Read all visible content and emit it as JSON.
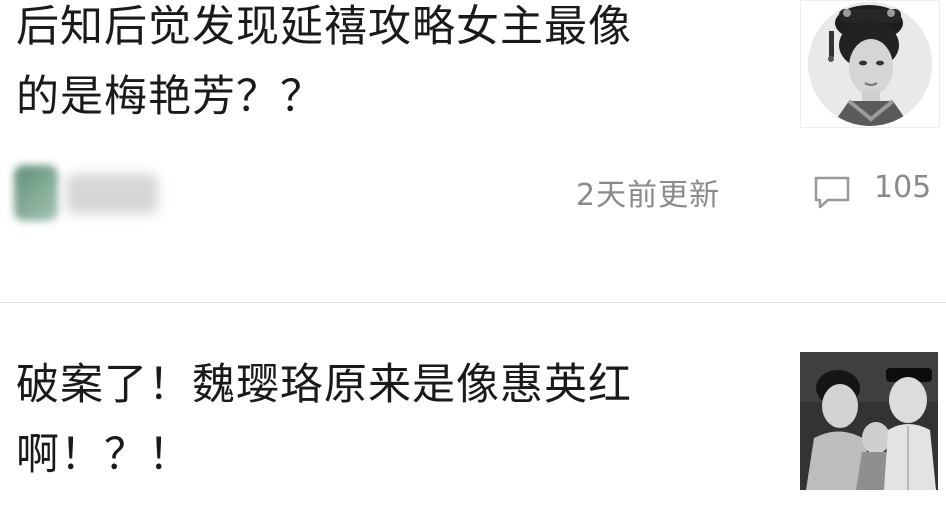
{
  "articles": [
    {
      "title_line1": "后知后觉发现延禧攻略女主最像",
      "title_line2": "的是梅艳芳？？",
      "updated": "2天前更新",
      "comment_count": "105",
      "thumbnail": "portrait-photo",
      "comment_icon": "comment-bubble-icon"
    },
    {
      "title_line1": "破案了！魏璎珞原来是像惠英红",
      "title_line2": "啊！？！",
      "thumbnail": "film-still-photo"
    }
  ]
}
